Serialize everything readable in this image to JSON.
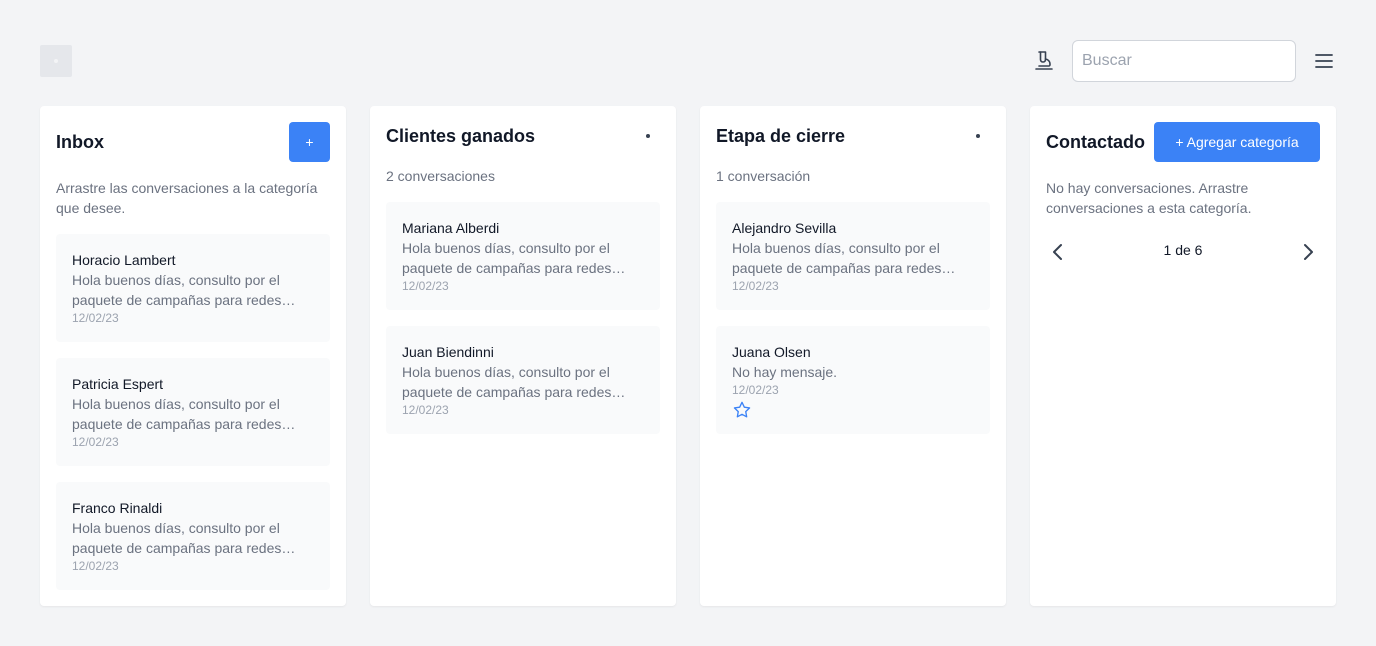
{
  "header": {
    "search_placeholder": "Buscar",
    "icons": {
      "logo": "logo-placeholder",
      "test": "test-tube-icon",
      "menu": "hamburger-menu-icon"
    }
  },
  "colors": {
    "accent": "#3b82f6",
    "background": "#f3f4f6",
    "card": "#f9fafb",
    "star": "#3b82f6"
  },
  "columns": [
    {
      "title": "Inbox",
      "add_button": "+",
      "hint": "Arrastre las conversaciones a la categoría que desee.",
      "cards": [
        {
          "name": "Horacio Lambert",
          "message": "Hola buenos días, consulto por el paquete de campañas para redes sociales.",
          "date": "12/02/23"
        },
        {
          "name": "Patricia Espert",
          "message": "Hola buenos días, consulto por el paquete de campañas para redes sociales.",
          "date": "12/02/23"
        },
        {
          "name": "Franco Rinaldi",
          "message": "Hola buenos días, consulto por el paquete de campañas para redes sociales.",
          "date": "12/02/23"
        }
      ]
    },
    {
      "title": "Clientes ganados",
      "count": "2 conversaciones",
      "cards": [
        {
          "name": "Mariana Alberdi",
          "message": "Hola buenos días, consulto por el paquete de campañas para redes sociales.",
          "date": "12/02/23"
        },
        {
          "name": "Juan Biendinni",
          "message": "Hola buenos días, consulto por el paquete de campañas para redes sociales.",
          "date": "12/02/23"
        }
      ]
    },
    {
      "title": "Etapa de cierre",
      "count": "1 conversación",
      "cards": [
        {
          "name": "Alejandro Sevilla",
          "message": "Hola buenos días, consulto por el paquete de campañas para redes sociales.",
          "date": "12/02/23"
        },
        {
          "name": "Juana Olsen",
          "message": "No hay mensaje.",
          "date": "12/02/23",
          "starred": true
        }
      ]
    },
    {
      "title": "Contactado",
      "add_category_button": "+ Agregar categoría",
      "empty_text": "No hay conversaciones. Arrastre conversaciones a esta categoría.",
      "pager": {
        "text": "1 de 6"
      }
    }
  ]
}
